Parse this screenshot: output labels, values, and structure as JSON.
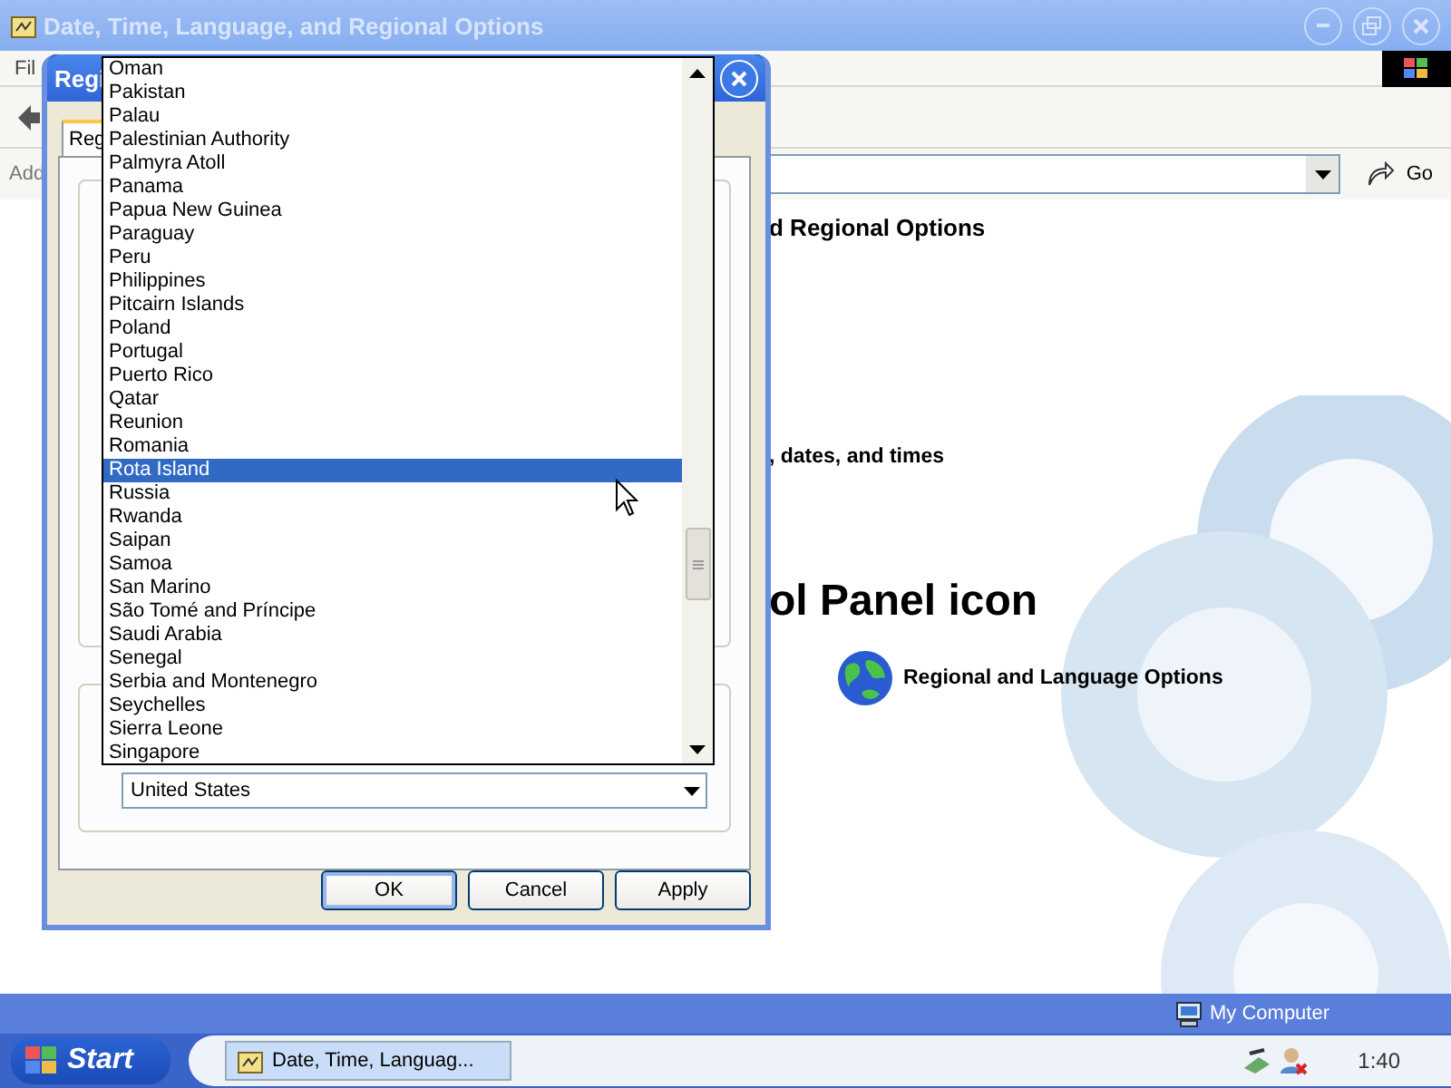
{
  "window": {
    "title": "Date, Time, Language, and Regional Options",
    "menu": [
      "Fil"
    ],
    "address_label": "Add",
    "go_button": "Go",
    "content": {
      "heading": "d Regional Options",
      "subheading": ", dates, and times",
      "section_title": "ol Panel icon",
      "link": "Regional and Language Options"
    },
    "status_bar": "My Computer"
  },
  "dialog": {
    "title": "Regi",
    "tabs": [
      {
        "label": "Reg",
        "selected": true
      }
    ],
    "dropdown": {
      "value": "United States",
      "expanded": true,
      "options": [
        {
          "label": "Oman",
          "selected": false
        },
        {
          "label": "Pakistan",
          "selected": false
        },
        {
          "label": "Palau",
          "selected": false
        },
        {
          "label": "Palestinian Authority",
          "selected": false
        },
        {
          "label": "Palmyra Atoll",
          "selected": false
        },
        {
          "label": "Panama",
          "selected": false
        },
        {
          "label": "Papua New Guinea",
          "selected": false
        },
        {
          "label": "Paraguay",
          "selected": false
        },
        {
          "label": "Peru",
          "selected": false
        },
        {
          "label": "Philippines",
          "selected": false
        },
        {
          "label": "Pitcairn Islands",
          "selected": false
        },
        {
          "label": "Poland",
          "selected": false
        },
        {
          "label": "Portugal",
          "selected": false
        },
        {
          "label": "Puerto Rico",
          "selected": false
        },
        {
          "label": "Qatar",
          "selected": false
        },
        {
          "label": "Reunion",
          "selected": false
        },
        {
          "label": "Romania",
          "selected": false
        },
        {
          "label": "Rota Island",
          "selected": true
        },
        {
          "label": "Russia",
          "selected": false
        },
        {
          "label": "Rwanda",
          "selected": false
        },
        {
          "label": "Saipan",
          "selected": false
        },
        {
          "label": "Samoa",
          "selected": false
        },
        {
          "label": "San Marino",
          "selected": false
        },
        {
          "label": "São Tomé and Príncipe",
          "selected": false
        },
        {
          "label": "Saudi Arabia",
          "selected": false
        },
        {
          "label": "Senegal",
          "selected": false
        },
        {
          "label": "Serbia and Montenegro",
          "selected": false
        },
        {
          "label": "Seychelles",
          "selected": false
        },
        {
          "label": "Sierra Leone",
          "selected": false
        },
        {
          "label": "Singapore",
          "selected": false
        }
      ]
    },
    "buttons": [
      {
        "label": "OK",
        "default": true
      },
      {
        "label": "Cancel",
        "default": false
      },
      {
        "label": "Apply",
        "default": false
      }
    ]
  },
  "taskbar": {
    "start": "Start",
    "tasks": [
      "Date, Time, Languag..."
    ],
    "clock": "1:40"
  }
}
